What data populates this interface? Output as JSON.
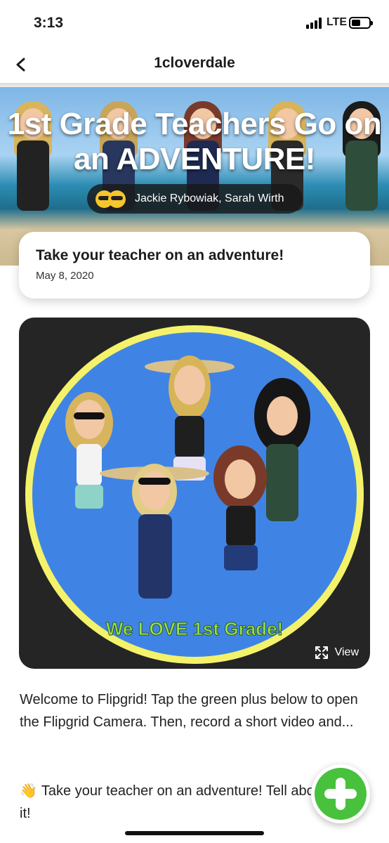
{
  "status_bar": {
    "time": "3:13",
    "network": "LTE"
  },
  "nav": {
    "title": "1cloverdale"
  },
  "banner": {
    "title": "1st Grade Teachers Go on an ADVENTURE!",
    "authors": "Jackie Rybowiak, Sarah Wirth"
  },
  "topic": {
    "title": "Take your teacher on an adventure!",
    "date": "May 8, 2020"
  },
  "media": {
    "image_caption": "We LOVE 1st Grade!",
    "view_label": "View"
  },
  "description": {
    "text": "Welcome to Flipgrid! Tap the green plus below to open the Flipgrid Camera. Then, record a short video and...",
    "prompt": "Take your teacher on an adventure! Tell about it!"
  },
  "icons": {
    "back": "chevron-left-icon",
    "view": "expand-icon",
    "wave": "waving-hand-icon",
    "add": "plus-icon"
  },
  "colors": {
    "accent_green": "#48c13d",
    "media_bg": "#252525",
    "circle_blue": "#3f84e5",
    "circle_border": "#f4f26a"
  }
}
